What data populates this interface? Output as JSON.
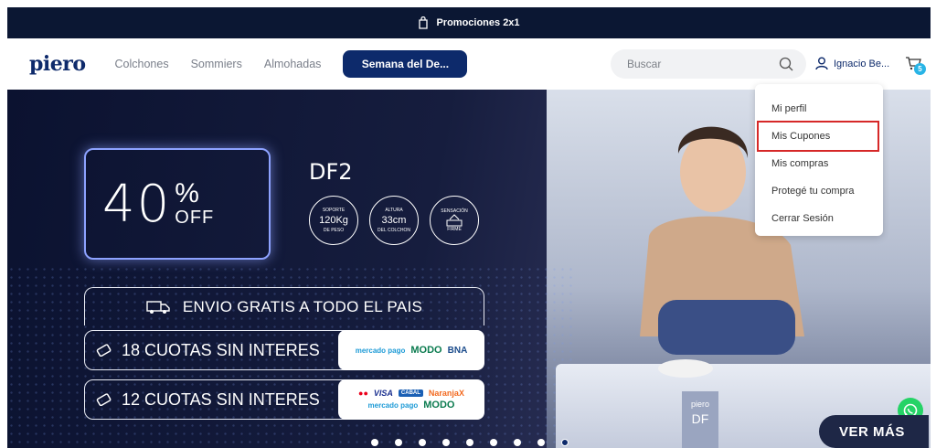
{
  "promo": {
    "text": "Promociones 2x1",
    "icon": "shopping-bag-icon"
  },
  "nav": {
    "logo": "piero",
    "links": [
      "Colchones",
      "Sommiers",
      "Almohadas"
    ],
    "cta": "Semana del De...",
    "search_placeholder": "Buscar",
    "user_name": "Ignacio Be...",
    "cart_count": "5"
  },
  "dropdown": {
    "items": [
      "Mi perfil",
      "Mis Cupones",
      "Mis compras",
      "Protegé tu compra",
      "Cerrar Sesión"
    ]
  },
  "hero": {
    "discount_number": "40",
    "discount_symbol": "%",
    "discount_off": "OFF",
    "model": "DF2",
    "badges": [
      {
        "top": "SOPORTE",
        "value": "120Kg",
        "bottom": "DE PESO"
      },
      {
        "top": "ALTURA",
        "value": "33cm",
        "bottom": "DEL COLCHON"
      },
      {
        "top": "SENSACIÓN",
        "value": "",
        "bottom": "FIRME"
      }
    ],
    "shipping": "ENVIO GRATIS A TODO EL PAIS",
    "installments_1": "18 CUOTAS SIN INTERES",
    "installments_2": "12 CUOTAS SIN INTERES",
    "pay_logos_1": {
      "mp": "mercado pago",
      "modo": "MODO",
      "bna": "BNA"
    },
    "pay_logos_2": {
      "visa": "VISA",
      "cabal": "CABAL",
      "naranja": "NaranjaX",
      "mp": "mercado pago",
      "modo": "MODO"
    },
    "mattress_brand": "piero",
    "mattress_model": "DF",
    "ver_mas": "VER MÁS"
  },
  "carousel": {
    "total_slides": 9,
    "active_index": 8
  },
  "colors": {
    "navy": "#0d2a6b",
    "promo_bg": "#0b1733",
    "accent_cyan": "#28b4e6",
    "highlight_red": "#d62828"
  }
}
